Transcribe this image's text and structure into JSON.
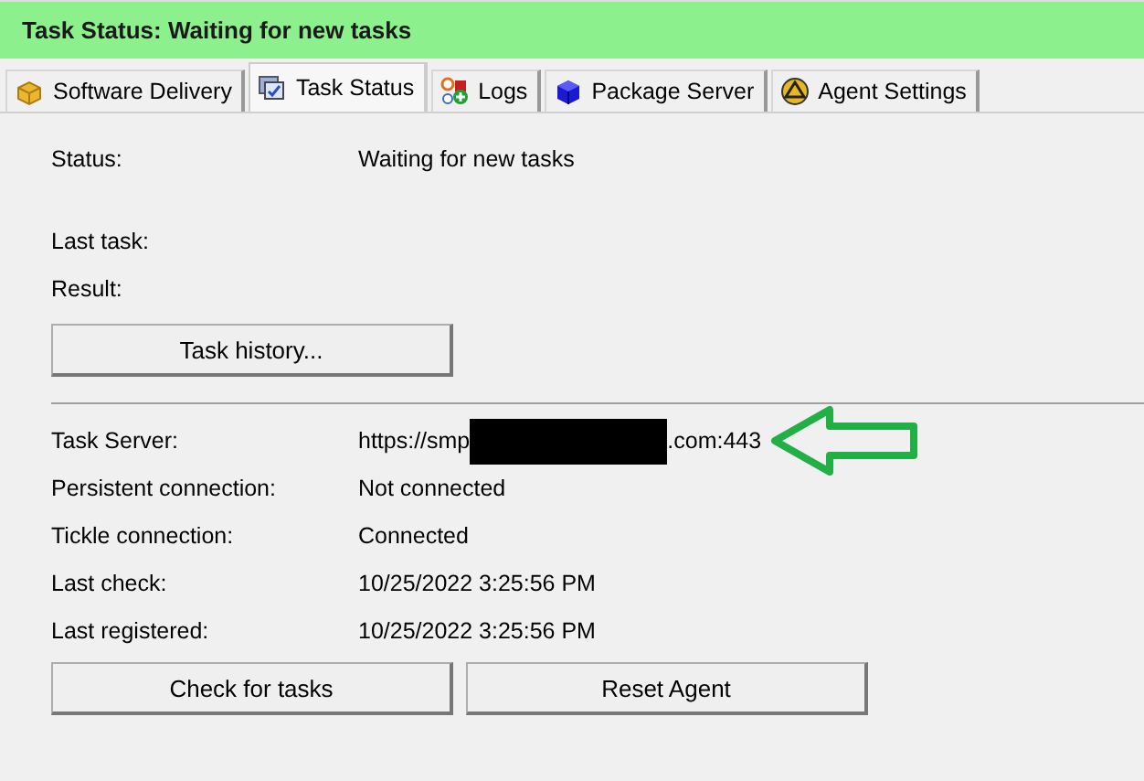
{
  "window": {
    "title": "Task Status: Waiting for new tasks"
  },
  "tabs": [
    {
      "label": "Software Delivery",
      "kind": "box",
      "selected": false
    },
    {
      "label": "Task Status",
      "kind": "task",
      "selected": true
    },
    {
      "label": "Logs",
      "kind": "logs",
      "selected": false
    },
    {
      "label": "Package Server",
      "kind": "cube",
      "selected": false
    },
    {
      "label": "Agent Settings",
      "kind": "agent",
      "selected": false
    }
  ],
  "status_section": {
    "rows": [
      {
        "label": "Status:",
        "value": "Waiting for new tasks"
      },
      {
        "label": "Last task:"
      },
      {
        "label": "Result:"
      }
    ],
    "buttons": [
      "Task history..."
    ]
  },
  "server_section": {
    "rows": [
      {
        "label": "Task Server:",
        "value": "https://smp",
        "redacted": true,
        "value_after": ".com:443",
        "arrow": true
      },
      {
        "label": "Persistent connection:",
        "value": "Not connected"
      },
      {
        "label": "Tickle connection:",
        "value": "Connected"
      },
      {
        "label": "Last check:",
        "value": "10/25/2022 3:25:56 PM"
      },
      {
        "label": "Last registered:",
        "value": "10/25/2022 3:25:56 PM"
      }
    ],
    "buttons": [
      "Check for tasks",
      "Reset Agent"
    ]
  }
}
